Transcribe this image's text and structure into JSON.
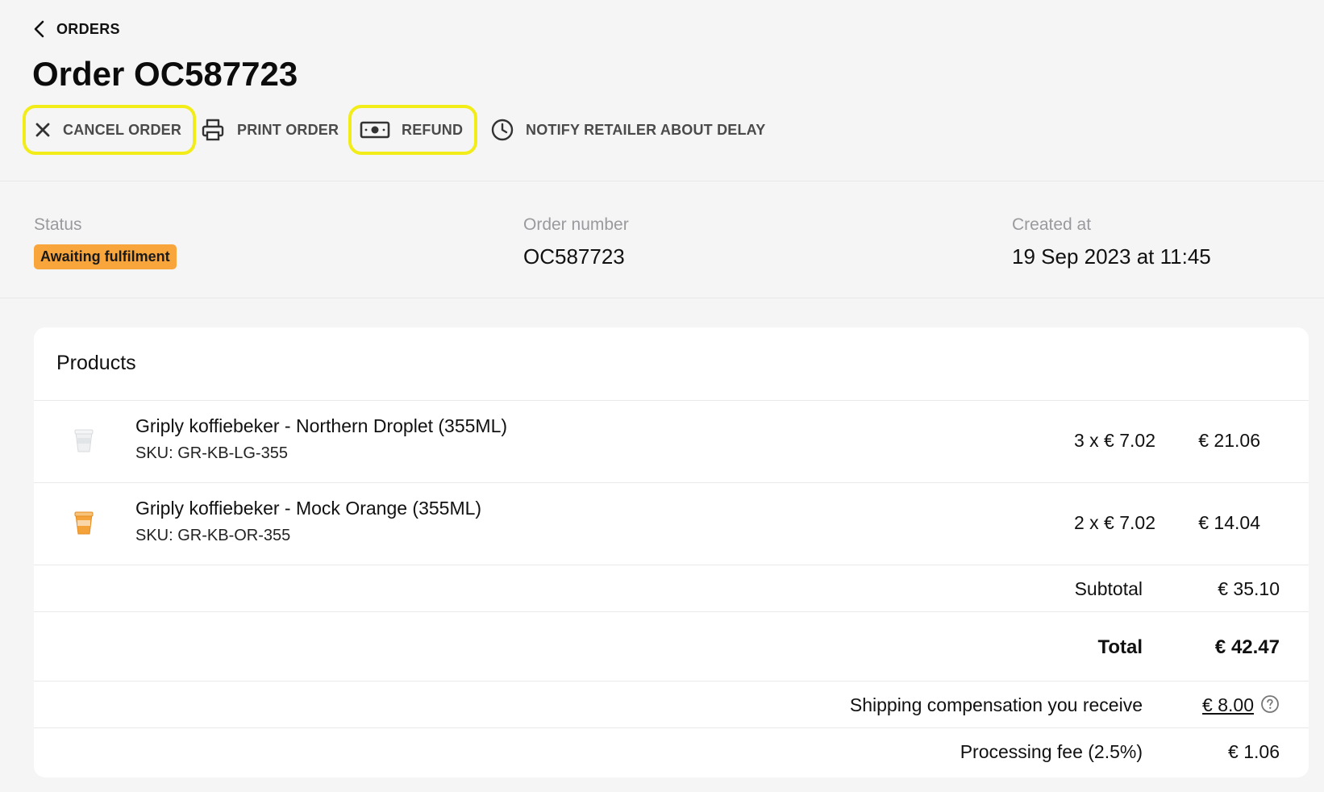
{
  "nav": {
    "back_label": "ORDERS"
  },
  "page": {
    "title": "Order OC587723"
  },
  "actions": {
    "cancel_label": "CANCEL ORDER",
    "print_label": "PRINT ORDER",
    "refund_label": "REFUND",
    "notify_label": "NOTIFY RETAILER ABOUT DELAY"
  },
  "info": {
    "status_label": "Status",
    "status_value": "Awaiting fulfilment",
    "order_number_label": "Order number",
    "order_number_value": "OC587723",
    "created_label": "Created at",
    "created_value": "19 Sep 2023 at 11:45"
  },
  "products": {
    "title": "Products",
    "items": [
      {
        "name": "Griply koffiebeker - Northern Droplet (355ML)",
        "sku": "SKU: GR-KB-LG-355",
        "qty": "3 x € 7.02",
        "total": "€ 21.06",
        "thumb_color": "#e9ecef"
      },
      {
        "name": "Griply koffiebeker - Mock Orange (355ML)",
        "sku": "SKU: GR-KB-OR-355",
        "qty": "2 x € 7.02",
        "total": "€ 14.04",
        "thumb_color": "#f4a23a"
      }
    ]
  },
  "summary": {
    "subtotal_label": "Subtotal",
    "subtotal_value": "€ 35.10",
    "total_label": "Total",
    "total_value": "€ 42.47",
    "shipping_label": "Shipping compensation you receive",
    "shipping_value": "€ 8.00",
    "fee_label": "Processing fee (2.5%)",
    "fee_value": "€ 1.06"
  },
  "colors": {
    "highlight": "#f2ec19",
    "badge": "#f8a63c"
  },
  "icons": [
    "chevron-left-icon",
    "close-icon",
    "printer-icon",
    "cash-icon",
    "clock-icon",
    "help-circle-icon"
  ]
}
